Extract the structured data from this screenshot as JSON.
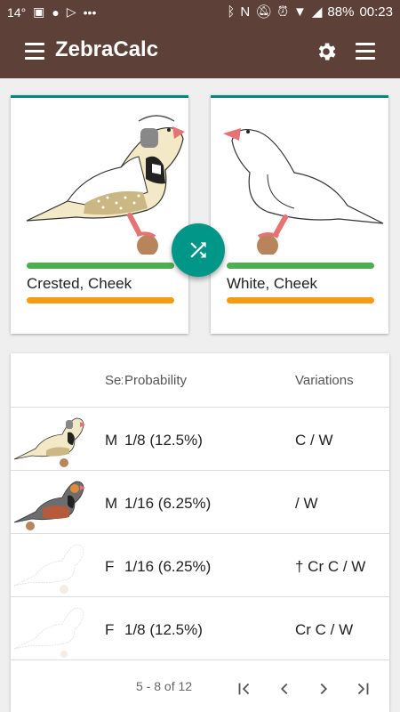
{
  "status": {
    "temp": "14°",
    "battery": "88%",
    "time": "00:23"
  },
  "appbar": {
    "title": "ZebraCalc"
  },
  "parents": [
    {
      "label": "Crested, Cheek"
    },
    {
      "label": "White, Cheek"
    }
  ],
  "table": {
    "headers": {
      "sex": "Sex",
      "probability": "Probability",
      "variations": "Variations"
    },
    "rows": [
      {
        "sex": "M",
        "probability": "1/8 (12.5%)",
        "variations": "C / W"
      },
      {
        "sex": "M",
        "probability": "1/16 (6.25%)",
        "variations": "/ W"
      },
      {
        "sex": "F",
        "probability": "1/16 (6.25%)",
        "variations": "† Cr C / W"
      },
      {
        "sex": "F",
        "probability": "1/8 (12.5%)",
        "variations": "Cr C / W"
      }
    ],
    "pager": {
      "range": "5 - 8 of 12"
    }
  },
  "icons": {
    "menu": "menu-icon",
    "settings": "gear-icon",
    "more": "more-menu-icon",
    "shuffle": "shuffle-icon",
    "first": "first-page-icon",
    "prev": "chevron-left-icon",
    "next": "chevron-right-icon",
    "last": "last-page-icon"
  },
  "colors": {
    "appbar": "#5d4037",
    "accent": "#009688",
    "bar_green": "#4caf50",
    "bar_orange": "#f39c12"
  }
}
